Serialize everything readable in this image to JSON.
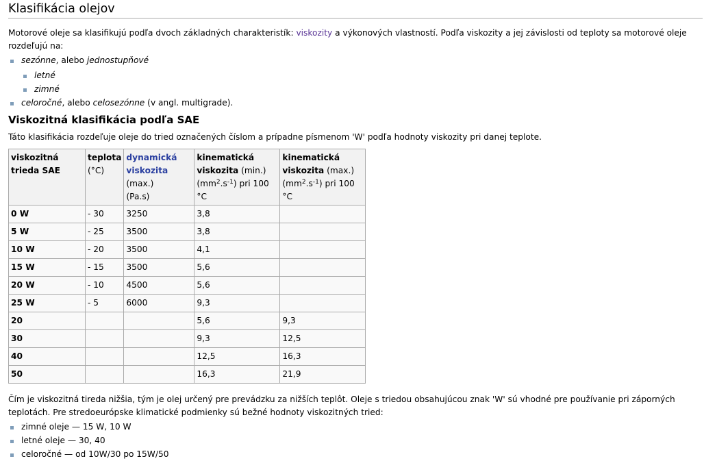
{
  "section_title": "Klasifikácia olejov",
  "intro": {
    "before": "Motorové oleje sa klasifikujú podľa dvoch základných charakteristík: ",
    "link": "viskozity",
    "after": " a výkonových vlastností. Podľa viskozity a jej závislosti od teploty sa motorové oleje rozdeľujú na:"
  },
  "types": {
    "seasonal_em": "sezónne",
    "seasonal_mid": ", alebo ",
    "seasonal_em2": "jednostupňové",
    "summer": "letné",
    "winter": "zimné",
    "allyear_em": "celoročné",
    "allyear_mid": ", alebo ",
    "allyear_em2": "celosezónne",
    "allyear_after": " (v angl. multigrade)."
  },
  "sae_title": "Viskozitná klasifikácia podľa SAE",
  "sae_intro": "Táto klasifikácia rozdeľuje oleje do tried označených číslom a prípadne písmenom 'W' podľa hodnoty viskozity pri danej teplote.",
  "table": {
    "h1": "viskozitná trieda SAE",
    "h2_bold": "teplota",
    "h2_unit": "(°C)",
    "h3_link": "dynamická viskozita",
    "h3_rest": " (max.)",
    "h3_unit": "(Pa.s)",
    "h4_bold": "kinematická viskozita",
    "h4_rest": " (min.)",
    "h4_unit_a": "(mm",
    "h4_sup1": "2",
    "h4_unit_b": ".s",
    "h4_sup2": "-1",
    "h4_unit_c": ") pri 100 °C",
    "h5_bold": "kinematická viskozita",
    "h5_rest": " (max.)",
    "h5_unit_a": "(mm",
    "h5_sup1": "2",
    "h5_unit_b": ".s",
    "h5_sup2": "-1",
    "h5_unit_c": ") pri 100 °C",
    "rows": [
      [
        "0 W",
        "- 30",
        "3250",
        "3,8",
        ""
      ],
      [
        "5 W",
        "- 25",
        "3500",
        "3,8",
        ""
      ],
      [
        "10 W",
        "- 20",
        "3500",
        "4,1",
        ""
      ],
      [
        "15 W",
        "- 15",
        "3500",
        "5,6",
        ""
      ],
      [
        "20 W",
        "- 10",
        "4500",
        "5,6",
        ""
      ],
      [
        "25 W",
        "- 5",
        "6000",
        "9,3",
        ""
      ],
      [
        "20",
        "",
        "",
        "5,6",
        "9,3"
      ],
      [
        "30",
        "",
        "",
        "9,3",
        "12,5"
      ],
      [
        "40",
        "",
        "",
        "12,5",
        "16,3"
      ],
      [
        "50",
        "",
        "",
        "16,3",
        "21,9"
      ]
    ]
  },
  "outro": "Čím je viskozitná tireda nižšia, tým je olej určený pre prevádzku za nižších teplôt. Oleje s triedou obsahujúcou znak 'W' sú vhodné pre používanie pri záporných teplotách. Pre stredoeurópske klimatické podmienky sú bežné hodnoty viskozitných tried:",
  "common": [
    "zimné oleje — 15 W, 10 W",
    "letné oleje — 30, 40",
    "celoročné — od 10W/30 po 15W/50"
  ]
}
